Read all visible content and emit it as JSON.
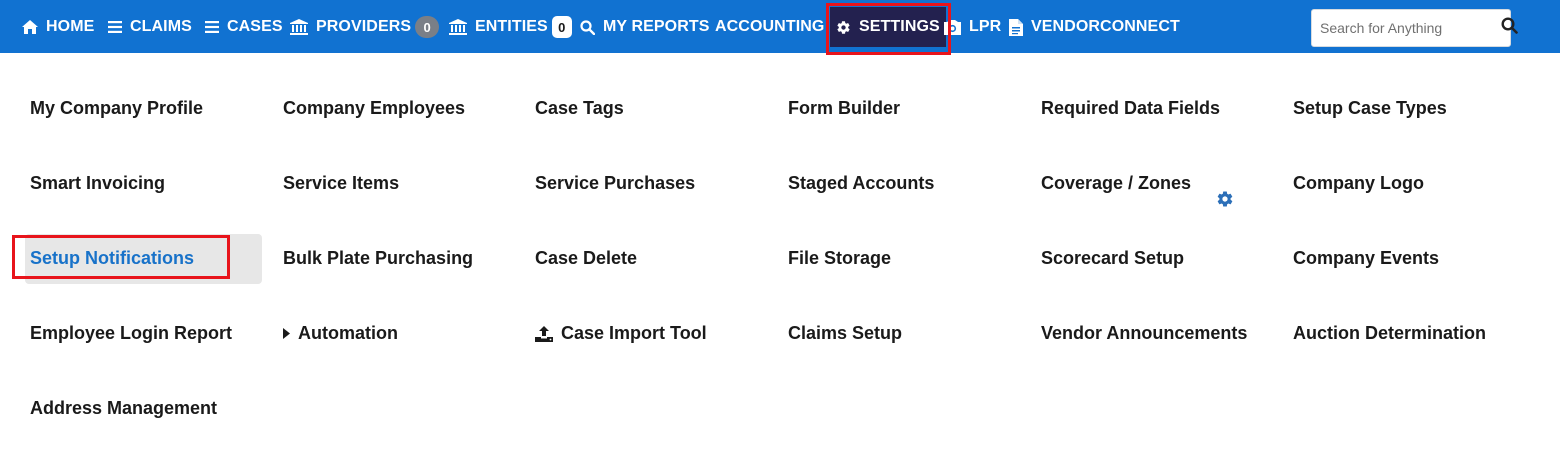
{
  "nav": {
    "home": "HOME",
    "claims": "CLAIMS",
    "cases": "CASES",
    "providers": "PROVIDERS",
    "providers_badge": "0",
    "entities": "ENTITIES",
    "entities_badge": "0",
    "my_reports": "MY REPORTS",
    "accounting": "ACCOUNTING",
    "settings": "SETTINGS",
    "lpr": "LPR",
    "vendorconnect": "VENDORCONNECT"
  },
  "search": {
    "placeholder": "Search for Anything"
  },
  "menu": {
    "col1": [
      "My Company Profile",
      "Smart Invoicing",
      "Setup Notifications",
      "Employee Login Report",
      "Address Management"
    ],
    "col2": [
      "Company Employees",
      "Service Items",
      "Bulk Plate Purchasing",
      "Automation"
    ],
    "col3": [
      "Case Tags",
      "Service Purchases",
      "Case Delete",
      "Case Import Tool"
    ],
    "col4": [
      "Form Builder",
      "Staged Accounts",
      "File Storage",
      "Claims Setup"
    ],
    "col5": [
      "Required Data Fields",
      "Coverage / Zones",
      "Scorecard Setup",
      "Vendor Announcements"
    ],
    "col6": [
      "Setup Case Types",
      "Company Logo",
      "Company Events",
      "Auction Determination"
    ]
  },
  "colors": {
    "nav_bg": "#1172d1",
    "active_bg": "#23214f",
    "highlight": "#e8141b",
    "selected_text": "#1872c9"
  },
  "icons": {
    "home": "home-icon",
    "claims": "hamburger-icon",
    "cases": "hamburger-icon",
    "providers": "bank-icon",
    "entities": "bank-icon",
    "reports": "search-icon",
    "settings": "gear-icon",
    "lpr": "camera-icon",
    "vendorconnect": "document-icon",
    "automation": "caret-right-icon",
    "import": "upload-icon"
  }
}
